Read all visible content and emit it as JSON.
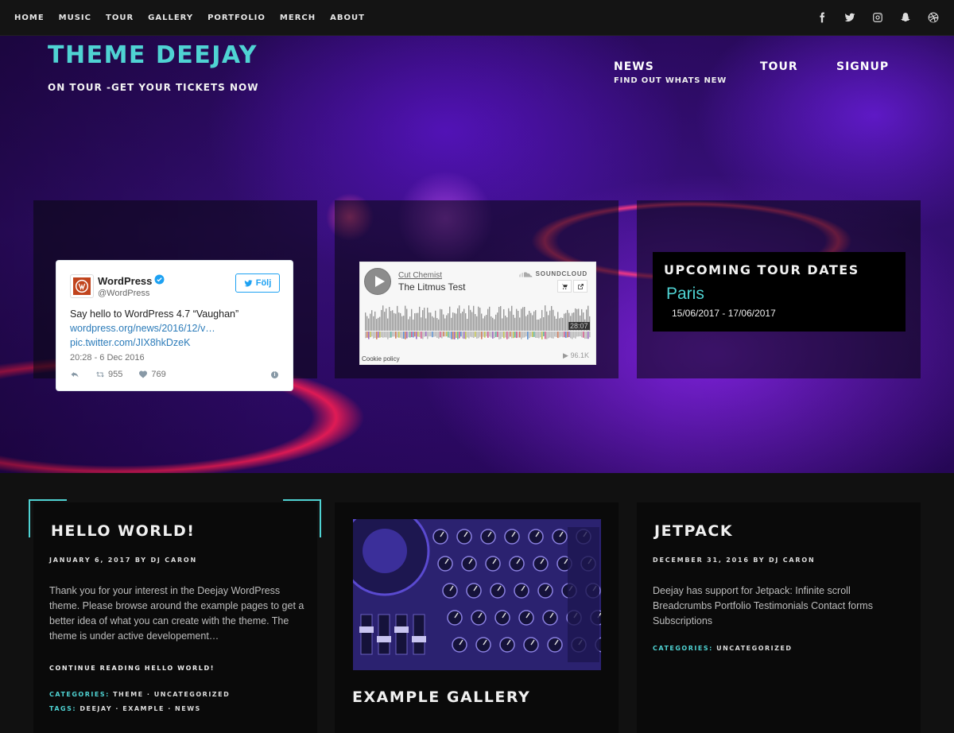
{
  "topnav": {
    "items": [
      "HOME",
      "MUSIC",
      "TOUR",
      "GALLERY",
      "PORTFOLIO",
      "MERCH",
      "ABOUT"
    ]
  },
  "social": [
    "facebook-icon",
    "twitter-icon",
    "instagram-icon",
    "snapchat-icon",
    "dribbble-icon"
  ],
  "hero": {
    "title": "THEME DEEJAY",
    "tagline": "ON TOUR -GET YOUR TICKETS NOW",
    "nav": [
      {
        "label": "NEWS",
        "sub": "FIND OUT WHATS NEW"
      },
      {
        "label": "TOUR",
        "sub": ""
      },
      {
        "label": "SIGNUP",
        "sub": ""
      }
    ]
  },
  "tweet": {
    "name": "WordPress",
    "handle": "@WordPress",
    "follow_label": "Följ",
    "text": "Say hello to WordPress 4.7 “Vaughan”",
    "link1": "wordpress.org/news/2016/12/v…",
    "link2": "pic.twitter.com/JIX8hkDzeK",
    "time": "20:28 - 6 Dec 2016",
    "retweets": "955",
    "likes": "769"
  },
  "soundcloud": {
    "artist": "Cut Chemist",
    "track": "The Litmus Test",
    "brand": "SOUNDCLOUD",
    "duration": "28:07",
    "cookie": "Cookie policy",
    "plays": "▶ 96.1K"
  },
  "tour": {
    "title": "UPCOMING TOUR DATES",
    "city": "Paris",
    "dates": "15/06/2017 - 17/06/2017"
  },
  "posts": [
    {
      "title": "HELLO WORLD!",
      "meta": "JANUARY 6, 2017 BY DJ CARON",
      "excerpt": "Thank you for your interest in the Deejay WordPress theme. Please browse around the example pages to get a better idea of what you can create with the theme. The theme is under active developement…",
      "more": "CONTINUE READING HELLO WORLD!",
      "categories_label": "CATEGORIES:",
      "categories": "THEME · UNCATEGORIZED",
      "tags_label": "TAGS:",
      "tags": "DEEJAY · EXAMPLE · NEWS"
    },
    {
      "title": "EXAMPLE GALLERY"
    },
    {
      "title": "JETPACK",
      "meta": "DECEMBER 31, 2016 BY DJ CARON",
      "excerpt": "Deejay has support for Jetpack: Infinite scroll Breadcrumbs Portfolio Testimonials Contact forms Subscriptions",
      "categories_label": "CATEGORIES:",
      "categories": "UNCATEGORIZED"
    }
  ],
  "colors": {
    "accent": "#4fd3d3",
    "link": "#2b7bb9",
    "background": "#111111"
  }
}
